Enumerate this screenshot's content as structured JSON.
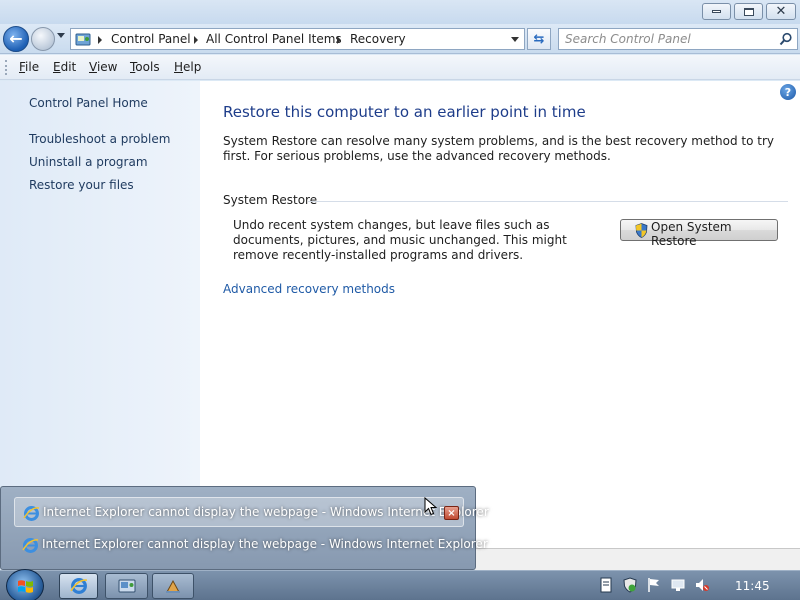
{
  "window": {
    "controls": {
      "minimize_icon": "minimize-icon",
      "maximize_icon": "restore-icon",
      "close_icon": "close-icon"
    }
  },
  "nav": {
    "back_icon": "back-arrow-icon",
    "forward_icon": "forward-arrow-icon",
    "breadcrumbs": [
      "Control Panel",
      "All Control Panel Items",
      "Recovery"
    ],
    "search_placeholder": "Search Control Panel"
  },
  "menu": {
    "items": [
      {
        "accel": "F",
        "rest": "ile"
      },
      {
        "accel": "E",
        "rest": "dit"
      },
      {
        "accel": "V",
        "rest": "iew"
      },
      {
        "accel": "T",
        "rest": "ools"
      },
      {
        "accel": "H",
        "rest": "elp"
      }
    ]
  },
  "sidebar": {
    "home": "Control Panel Home",
    "links": [
      "Troubleshoot a problem",
      "Uninstall a program",
      "Restore your files"
    ]
  },
  "main": {
    "help_icon": "?",
    "title": "Restore this computer to an earlier point in time",
    "intro": "System Restore can resolve many system problems, and is the best recovery method to try first. For serious problems, use the advanced recovery methods.",
    "section_header": "System Restore",
    "section_text": "Undo recent system changes, but leave files such as documents, pictures, and music unchanged. This might remove recently-installed programs and drivers.",
    "open_button": "Open System Restore",
    "advanced_link": "Advanced recovery methods"
  },
  "popup": {
    "items": [
      "Internet Explorer cannot display the webpage - Windows Internet Explorer",
      "Internet Explorer cannot display the webpage - Windows Internet Explorer"
    ],
    "close_glyph": "×"
  },
  "taskbar": {
    "clock": "11:45"
  },
  "colors": {
    "title_text": "#1e3d8a",
    "link": "#1f5aa6",
    "sidebar_bg": "#dfeaf7",
    "taskbar": "#5d738e"
  }
}
